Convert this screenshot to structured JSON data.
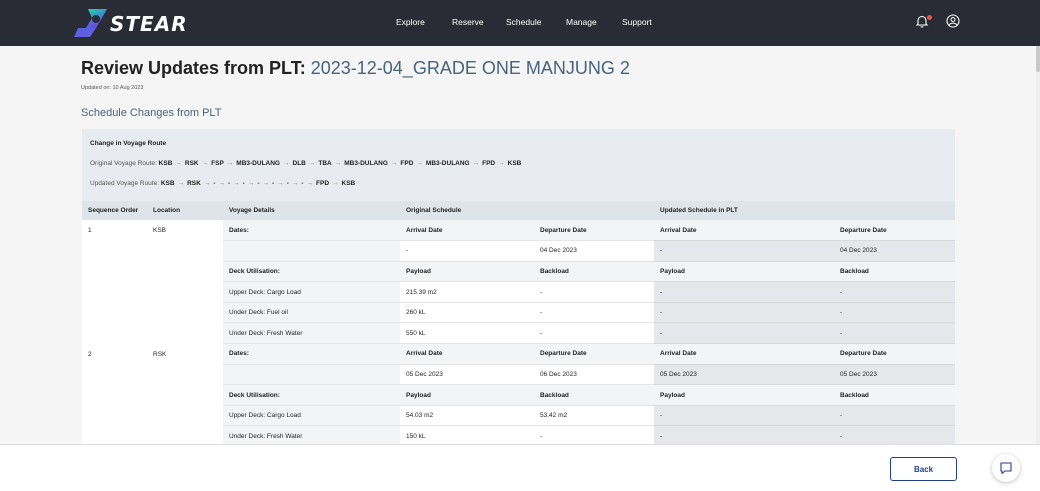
{
  "brand": {
    "name": "STEAR"
  },
  "nav": {
    "links": [
      "Explore",
      "Reserve",
      "Schedule",
      "Manage",
      "Support"
    ],
    "icons": [
      "bell-icon",
      "user-account-icon"
    ],
    "notification_color": "#e8563a"
  },
  "page": {
    "title_prefix": "Review Updates from PLT:",
    "title_plt": "2023-12-04_GRADE ONE MANJUNG 2",
    "updated_on": "Updated on: 10 Aug 2023",
    "section_title": "Schedule Changes from PLT"
  },
  "route": {
    "heading": "Change in Voyage Route",
    "original_label": "Original Voyage Route:",
    "original": [
      "KSB",
      "RSK",
      "FSP",
      "MB3-DULANG",
      "DLB",
      "TBA",
      "MB3-DULANG",
      "FPD",
      "MB3-DULANG",
      "FPD",
      "KSB"
    ],
    "updated_label": "Updated Voyage Route:",
    "updated": [
      "KSB",
      "RSK",
      "-",
      "-",
      "-",
      "-",
      "-",
      "-",
      "-",
      "FPD",
      "KSB"
    ]
  },
  "table": {
    "headers": [
      "Sequence Order",
      "Location",
      "Voyage Details",
      "Original Schedule",
      "Updated Schedule in PLT"
    ],
    "stops": [
      {
        "seq": "1",
        "location": "KSB",
        "rows": [
          [
            "Dates:",
            "Arrival Date",
            "Departure Date",
            "Arrival Date",
            "Departure Date"
          ],
          [
            "",
            "-",
            "04 Dec 2023",
            "-",
            "04 Dec 2023"
          ],
          [
            "Deck Utilisation:",
            "Payload",
            "Backload",
            "Payload",
            "Backload"
          ],
          [
            "Upper Deck: Cargo Load",
            "215.39 m2",
            "-",
            "-",
            "-"
          ],
          [
            "Under Deck: Fuel oil",
            "260 kL",
            "-",
            "-",
            "-"
          ],
          [
            "Under Deck: Fresh Water",
            "550 kL",
            "-",
            "-",
            "-"
          ]
        ]
      },
      {
        "seq": "2",
        "location": "RSK",
        "rows": [
          [
            "Dates:",
            "Arrival Date",
            "Departure Date",
            "Arrival Date",
            "Departure Date"
          ],
          [
            "",
            "05 Dec 2023",
            "06 Dec 2023",
            "05 Dec 2023",
            "05 Dec 2023"
          ],
          [
            "Deck Utilisation:",
            "Payload",
            "Backload",
            "Payload",
            "Backload"
          ],
          [
            "Upper Deck: Cargo Load",
            "54.03 m2",
            "53.42 m2",
            "-",
            "-"
          ],
          [
            "Under Deck: Fresh Water",
            "150 kL",
            "-",
            "-",
            "-"
          ]
        ]
      }
    ]
  },
  "footer": {
    "back_label": "Back",
    "chat_icon": "chat-icon"
  }
}
